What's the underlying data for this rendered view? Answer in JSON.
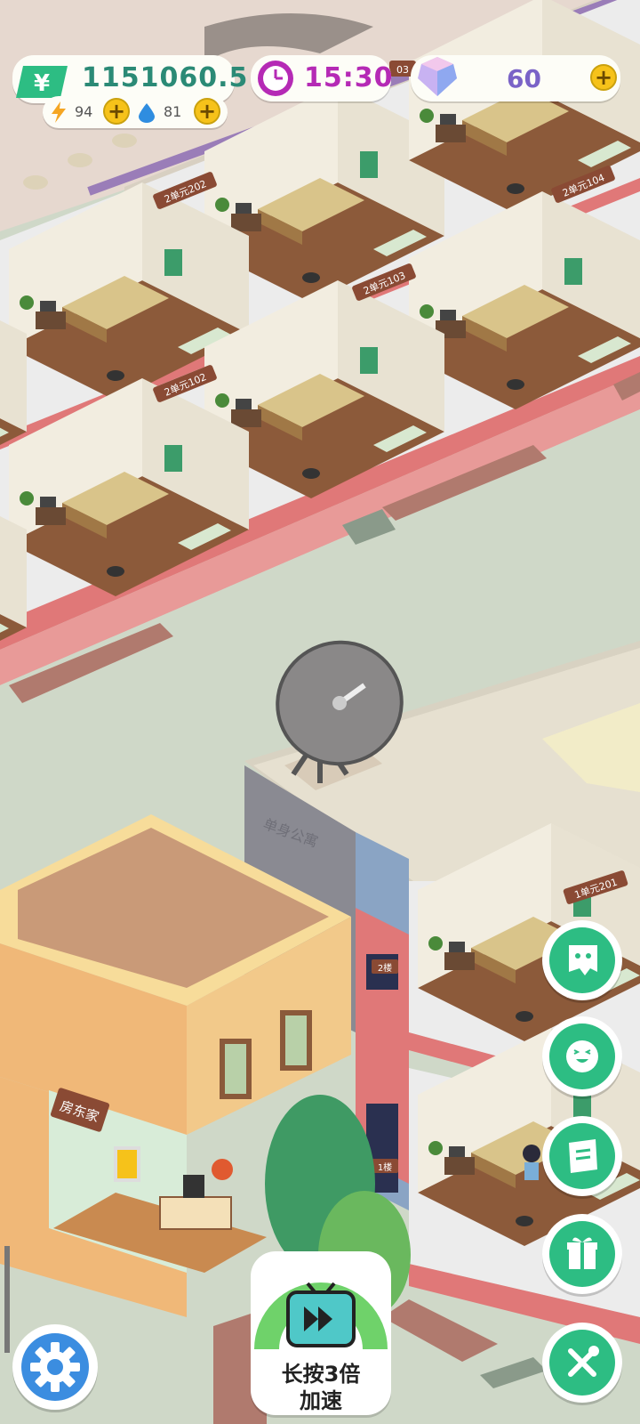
{
  "hud": {
    "money": "1151060.5",
    "money_icon": "yuan-bill-icon",
    "energy": "94",
    "energy_icon": "lightning-icon",
    "water": "81",
    "water_icon": "water-drop-icon",
    "time": "15:30",
    "time_icon": "clock-icon",
    "gems": "60",
    "gem_icon": "diamond-icon",
    "plus": "+"
  },
  "room_labels": {
    "r202": "2单元202",
    "r104": "2单元104",
    "r103": "2单元103",
    "r102": "2单元102",
    "r03": "03",
    "r201": "1单元201",
    "floor2": "2楼",
    "floor1": "1楼"
  },
  "buildings": {
    "apartment_name": "单身公寓",
    "landlord_sign": "房东家"
  },
  "boost": {
    "line1": "长按3倍",
    "line2": "加速"
  },
  "side_buttons": [
    "ghost-chat-icon",
    "smiley-icon",
    "note-icon",
    "gift-icon",
    "tools-icon"
  ],
  "colors": {
    "accent_green": "#2dbd83",
    "money_text": "#2b8a76",
    "time_text": "#b52ab5",
    "gem_text": "#7a63c7",
    "coin_yellow": "#f6c21a"
  }
}
